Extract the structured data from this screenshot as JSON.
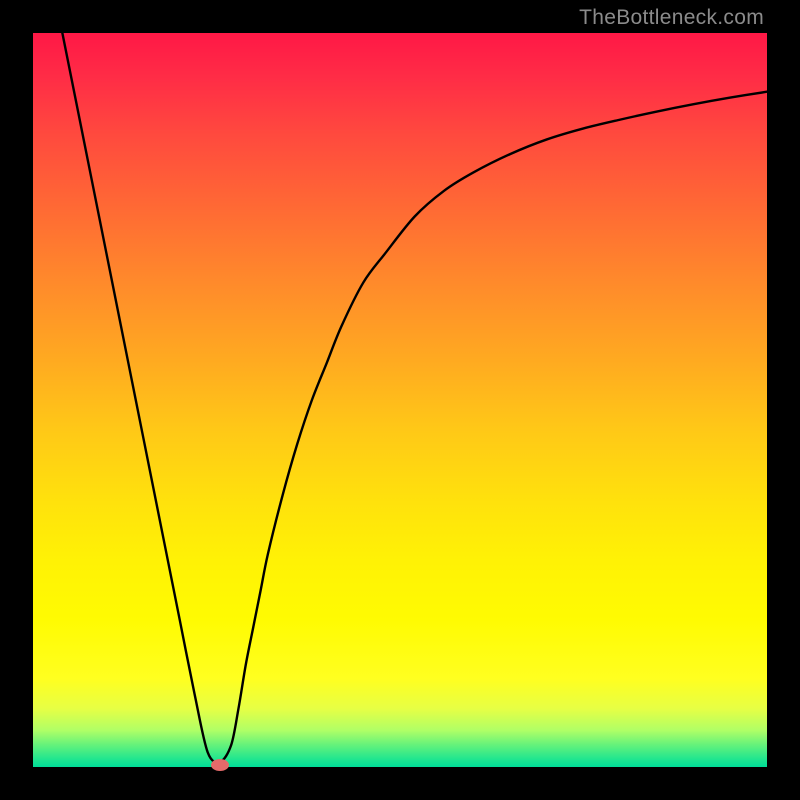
{
  "watermark": "TheBottleneck.com",
  "chart_data": {
    "type": "line",
    "title": "",
    "xlabel": "",
    "ylabel": "",
    "x_range": [
      0,
      100
    ],
    "y_range": [
      0,
      100
    ],
    "grid": false,
    "legend": false,
    "series": [
      {
        "name": "curve",
        "x": [
          4,
          6,
          8,
          10,
          12,
          14,
          16,
          18,
          20,
          22,
          23.8,
          25.5,
          27,
          28,
          29,
          30,
          31,
          32,
          34,
          36,
          38,
          40,
          42,
          45,
          48,
          52,
          56,
          60,
          65,
          70,
          75,
          80,
          85,
          90,
          95,
          100
        ],
        "y": [
          100,
          90,
          80,
          70,
          60,
          50,
          40,
          30,
          20,
          10,
          2,
          0.7,
          3,
          8,
          14,
          19,
          24,
          29,
          37,
          44,
          50,
          55,
          60,
          66,
          70,
          75,
          78.5,
          81,
          83.5,
          85.5,
          87,
          88.2,
          89.3,
          90.3,
          91.2,
          92
        ]
      }
    ],
    "marker": {
      "x": 25.5,
      "y": 0.3
    },
    "background_gradient": {
      "top": "#ff1846",
      "bottom": "#00dd98"
    }
  }
}
